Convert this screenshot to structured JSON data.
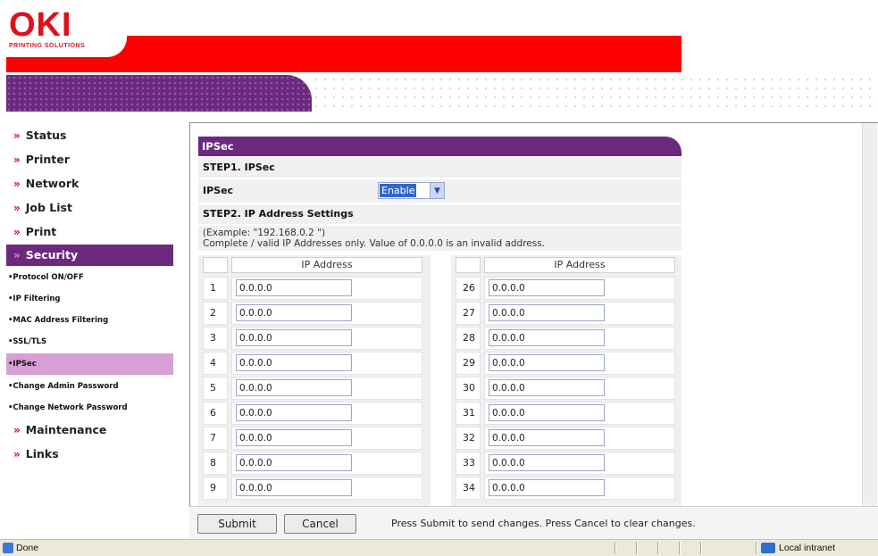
{
  "header": {
    "logo_text": "OKI",
    "logo_subtitle": "PRINTING SOLUTIONS"
  },
  "colors": {
    "brand_red": "#ff0000",
    "brand_purple": "#6b2a7d",
    "active_sub": "#d79fd6"
  },
  "sidebar": {
    "arrow": "»",
    "items": [
      {
        "label": "Status"
      },
      {
        "label": "Printer"
      },
      {
        "label": "Network"
      },
      {
        "label": "Job List"
      },
      {
        "label": "Print"
      },
      {
        "label": "Security"
      }
    ],
    "security_sub": [
      {
        "label": "•Protocol ON/OFF"
      },
      {
        "label": "•IP Filtering"
      },
      {
        "label": "•MAC Address Filtering"
      },
      {
        "label": "•SSL/TLS"
      },
      {
        "label": "•IPSec"
      },
      {
        "label": "•Change Admin Password"
      },
      {
        "label": "•Change Network Password"
      }
    ],
    "items_after": [
      {
        "label": "Maintenance"
      },
      {
        "label": "Links"
      }
    ]
  },
  "content": {
    "title": "IPSec",
    "step1": "STEP1.  IPSec",
    "ipsec_label": "IPSec",
    "ipsec_value": "Enable",
    "step2": "STEP2.  IP Address Settings",
    "note_line1": "(Example: \"192.168.0.2 \")",
    "note_line2": "Complete / valid IP Addresses only. Value of 0.0.0.0 is an invalid address.",
    "ip_header": "IP Address",
    "left_rows": [
      {
        "num": "1",
        "value": "0.0.0.0"
      },
      {
        "num": "2",
        "value": "0.0.0.0"
      },
      {
        "num": "3",
        "value": "0.0.0.0"
      },
      {
        "num": "4",
        "value": "0.0.0.0"
      },
      {
        "num": "5",
        "value": "0.0.0.0"
      },
      {
        "num": "6",
        "value": "0.0.0.0"
      },
      {
        "num": "7",
        "value": "0.0.0.0"
      },
      {
        "num": "8",
        "value": "0.0.0.0"
      },
      {
        "num": "9",
        "value": "0.0.0.0"
      }
    ],
    "right_rows": [
      {
        "num": "26",
        "value": "0.0.0.0"
      },
      {
        "num": "27",
        "value": "0.0.0.0"
      },
      {
        "num": "28",
        "value": "0.0.0.0"
      },
      {
        "num": "29",
        "value": "0.0.0.0"
      },
      {
        "num": "30",
        "value": "0.0.0.0"
      },
      {
        "num": "31",
        "value": "0.0.0.0"
      },
      {
        "num": "32",
        "value": "0.0.0.0"
      },
      {
        "num": "33",
        "value": "0.0.0.0"
      },
      {
        "num": "34",
        "value": "0.0.0.0"
      }
    ]
  },
  "actions": {
    "submit": "Submit",
    "cancel": "Cancel",
    "help": "Press Submit to send changes. Press Cancel to clear changes."
  },
  "statusbar": {
    "done": "Done",
    "zone": "Local intranet"
  }
}
